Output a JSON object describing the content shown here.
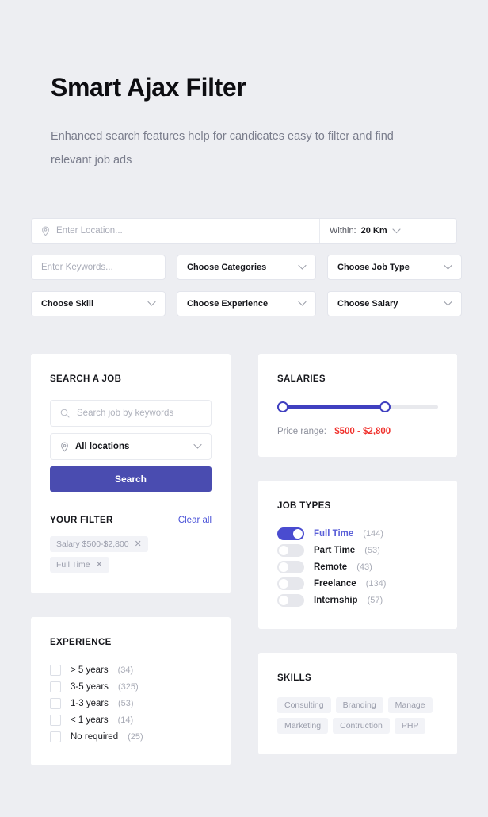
{
  "header": {
    "title": "Smart Ajax Filter",
    "subtitle": "Enhanced search features help for candicates easy to filter and find relevant job ads"
  },
  "topbar": {
    "location_placeholder": "Enter Location...",
    "within_label": "Within:",
    "within_value": "20 Km",
    "filters": [
      {
        "label": "Enter Keywords...",
        "type": "input"
      },
      {
        "label": "Choose Categories",
        "type": "select"
      },
      {
        "label": "Choose Job Type",
        "type": "select"
      },
      {
        "label": "Choose Skill",
        "type": "select"
      },
      {
        "label": "Choose Experience",
        "type": "select"
      },
      {
        "label": "Choose Salary",
        "type": "select"
      }
    ]
  },
  "search_card": {
    "title": "SEARCH A JOB",
    "keyword_placeholder": "Search job by keywords",
    "location_value": "All locations",
    "search_button": "Search",
    "filter_title": "YOUR FILTER",
    "clear_all": "Clear all",
    "tags": [
      {
        "label": "Salary $500-$2,800",
        "remove": "✕"
      },
      {
        "label": "Full Time",
        "remove": "✕"
      }
    ]
  },
  "experience_card": {
    "title": "EXPERIENCE",
    "items": [
      {
        "label": "> 5 years",
        "count": "(34)",
        "checked": false
      },
      {
        "label": "3-5 years",
        "count": "(325)",
        "checked": false
      },
      {
        "label": "1-3 years",
        "count": "(53)",
        "checked": false
      },
      {
        "label": "< 1 years",
        "count": "(14)",
        "checked": false
      },
      {
        "label": "No required",
        "count": "(25)",
        "checked": false
      }
    ]
  },
  "salaries_card": {
    "title": "SALARIES",
    "price_label": "Price range:",
    "price_value": "$500 - $2,800",
    "slider": {
      "fill_percent": 67,
      "handle_left_percent": 0,
      "handle_right_percent": 67
    }
  },
  "job_types_card": {
    "title": "JOB TYPES",
    "items": [
      {
        "label": "Full Time",
        "count": "(144)",
        "on": true
      },
      {
        "label": "Part Time",
        "count": "(53)",
        "on": false
      },
      {
        "label": "Remote",
        "count": "(43)",
        "on": false
      },
      {
        "label": "Freelance",
        "count": "(134)",
        "on": false
      },
      {
        "label": "Internship",
        "count": "(57)",
        "on": false
      }
    ]
  },
  "skills_card": {
    "title": "SKILLS",
    "tags": [
      "Consulting",
      "Branding",
      "Manage",
      "Marketing",
      "Contruction",
      "PHP"
    ]
  },
  "colors": {
    "accent": "#4a4cb0",
    "accent_light": "#5a5fd8",
    "price": "#f0332e",
    "background": "#edeef2"
  }
}
